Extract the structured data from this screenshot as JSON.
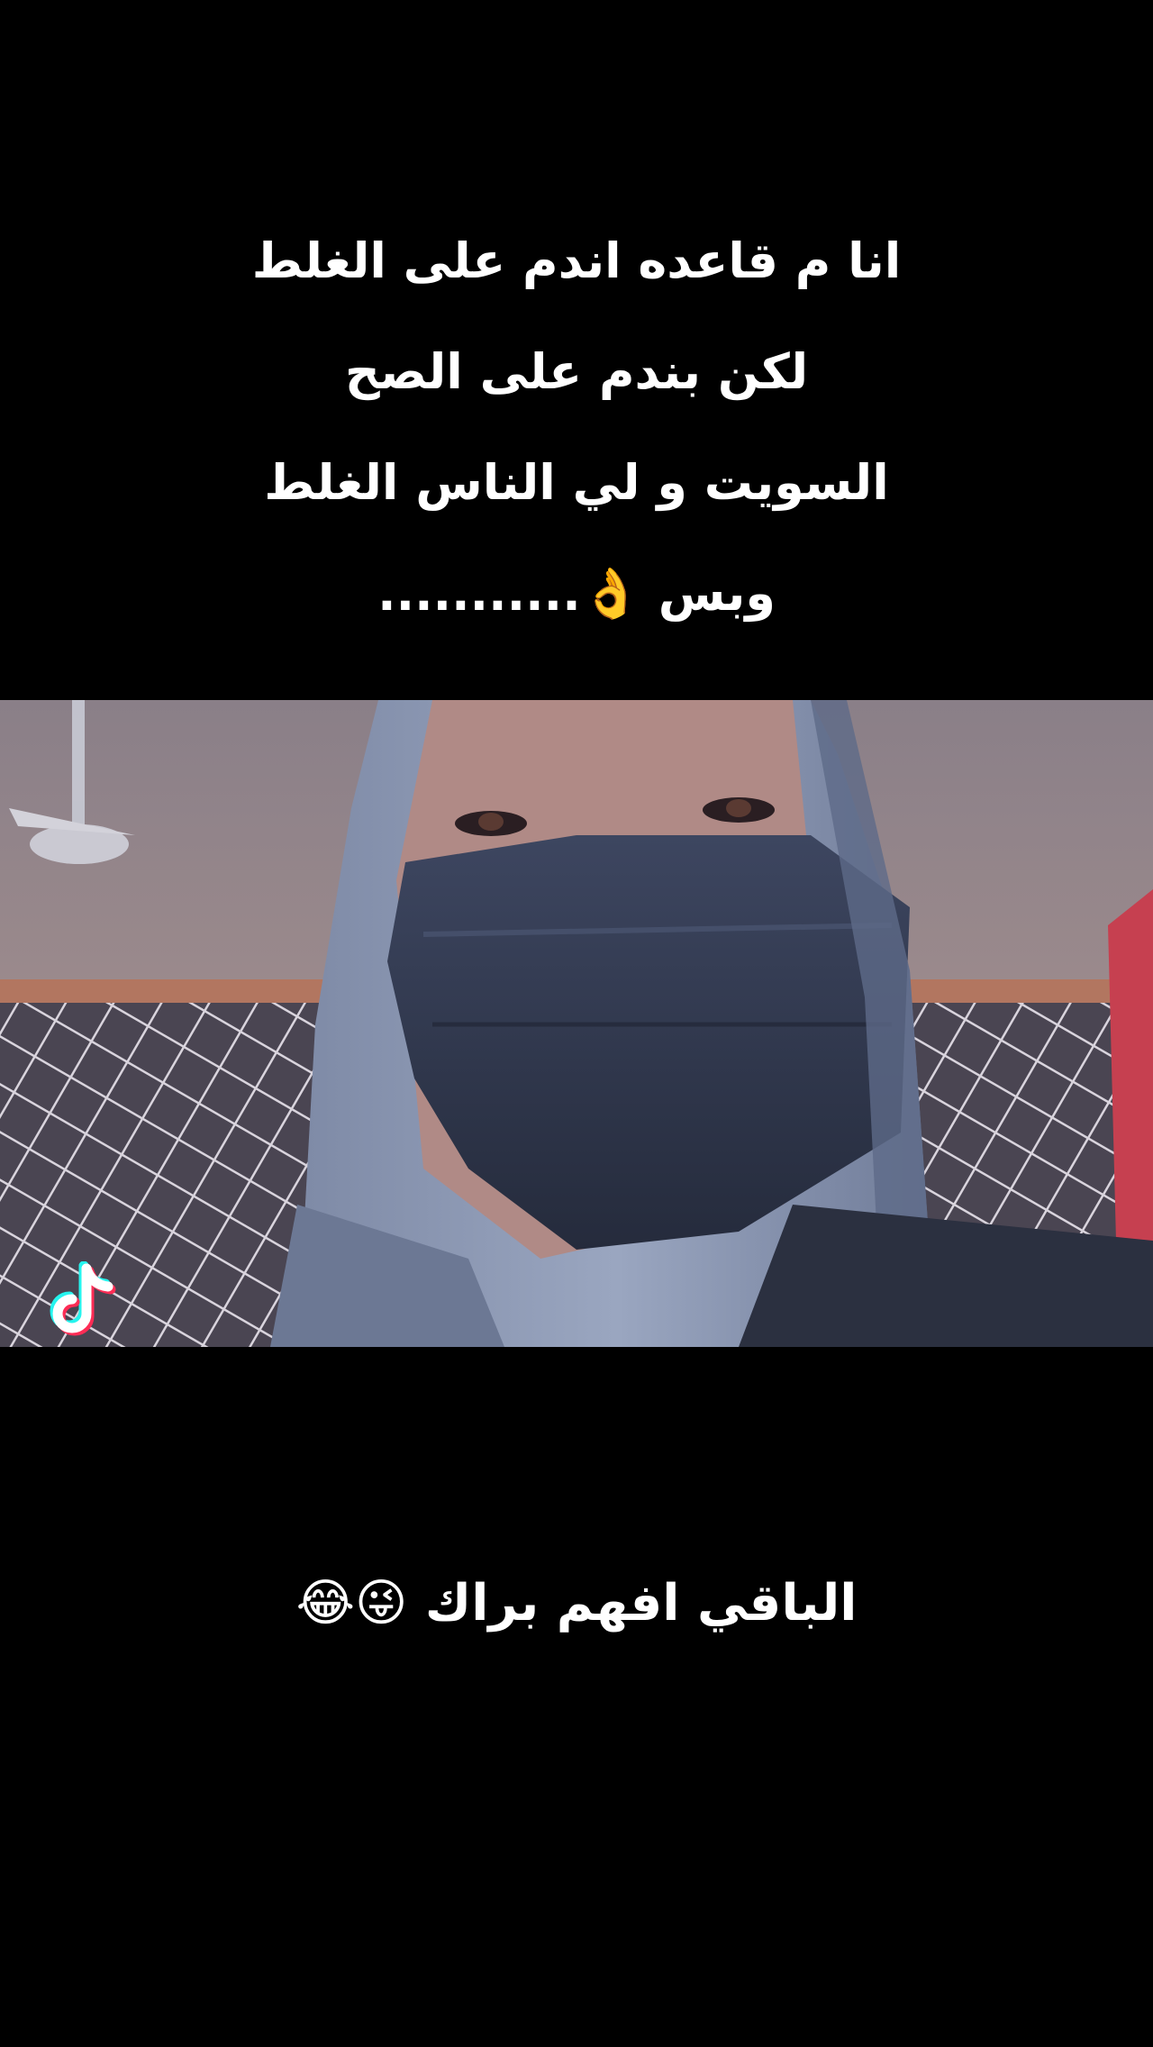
{
  "caption_top": {
    "line1": "انا م قاعده اندم على الغلط",
    "line2": "لكن بندم على الصح",
    "line3": "السويت و لي الناس الغلط",
    "line4": "وبس 👌..........."
  },
  "video": {
    "description_icon": "person-with-hood-and-mask-photo",
    "watermark_icon": "tiktok-logo-icon"
  },
  "caption_bottom": {
    "text": "الباقي افهم براك 😜😂"
  },
  "colors": {
    "background": "#000000",
    "text": "#ffffff",
    "mask": "#2e3548",
    "tiktok_cyan": "#25f4ee",
    "tiktok_red": "#fe2c55"
  }
}
